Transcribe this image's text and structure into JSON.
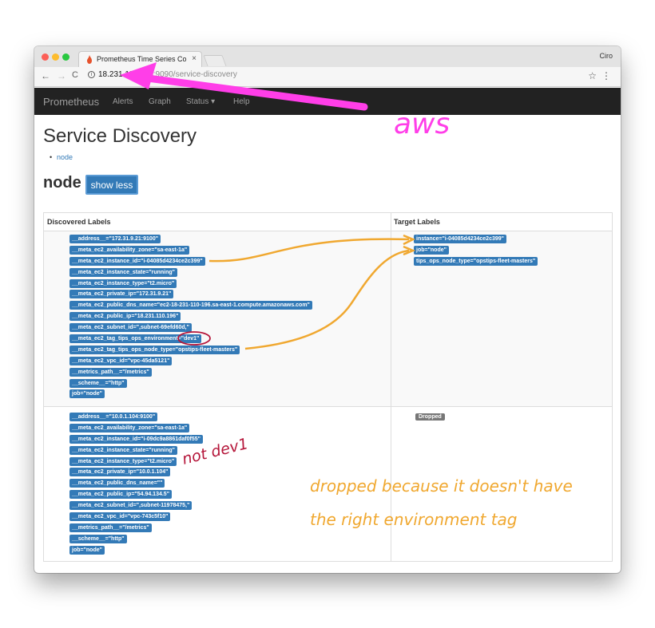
{
  "browser": {
    "tab_title": "Prometheus Time Series Colle",
    "tab_close": "×",
    "profile_name": "Ciro",
    "url_host": "18.231.110.196",
    "url_rest": ":9090/service-discovery",
    "back": "←",
    "forward": "→",
    "reload": "C",
    "info": "i",
    "star": "☆",
    "menu": "⋮"
  },
  "navbar": {
    "brand": "Prometheus",
    "links": [
      "Alerts",
      "Graph",
      "Status ▾",
      "Help"
    ],
    "background": "#222222",
    "link_color": "#9d9d9d"
  },
  "page": {
    "title": "Service Discovery",
    "jobs": [
      "node"
    ],
    "bullet": "•",
    "pool_title": "node",
    "toggle_label": "show less"
  },
  "table": {
    "headers": [
      "Discovered Labels",
      "Target Labels"
    ],
    "rows": [
      {
        "discovered": [
          "__address__=\"172.31.9.21:9100\"",
          "__meta_ec2_availability_zone=\"sa-east-1a\"",
          "__meta_ec2_instance_id=\"i-04085d4234ce2c399\"",
          "__meta_ec2_instance_state=\"running\"",
          "__meta_ec2_instance_type=\"t2.micro\"",
          "__meta_ec2_private_ip=\"172.31.9.21\"",
          "__meta_ec2_public_dns_name=\"ec2-18-231-110-196.sa-east-1.compute.amazonaws.com\"",
          "__meta_ec2_public_ip=\"18.231.110.196\"",
          "__meta_ec2_subnet_id=\",subnet-69efd60d,\"",
          "__meta_ec2_tag_tips_ops_environment=\"dev1\"",
          "__meta_ec2_tag_tips_ops_node_type=\"opstips-fleet-masters\"",
          "__meta_ec2_vpc_id=\"vpc-45da5121\"",
          "__metrics_path__=\"/metrics\"",
          "__scheme__=\"http\"",
          "job=\"node\""
        ],
        "target": [
          "instance=\"i-04085d4234ce2c399\"",
          "job=\"node\"",
          "tips_ops_node_type=\"opstips-fleet-masters\""
        ]
      },
      {
        "discovered": [
          "__address__=\"10.0.1.104:9100\"",
          "__meta_ec2_availability_zone=\"sa-east-1a\"",
          "__meta_ec2_instance_id=\"i-09dc9a8861daf0f55\"",
          "__meta_ec2_instance_state=\"running\"",
          "__meta_ec2_instance_type=\"t2.micro\"",
          "__meta_ec2_private_ip=\"10.0.1.104\"",
          "__meta_ec2_public_dns_name=\"\"",
          "__meta_ec2_public_ip=\"54.94.134.5\"",
          "__meta_ec2_subnet_id=\",subnet-11978475,\"",
          "__meta_ec2_vpc_id=\"vpc-743c5f10\"",
          "__metrics_path__=\"/metrics\"",
          "__scheme__=\"http\"",
          "job=\"node\""
        ],
        "status": "Dropped"
      }
    ]
  },
  "annotations": {
    "aws": "aws",
    "not_dev1": "not dev1",
    "dropped_line1": "dropped because it doesn't have",
    "dropped_line2": "the right environment tag",
    "arrow_pink": "#ff3ee8",
    "arrow_orange": "#f0a830",
    "circle_red": "#b5163a"
  },
  "colors": {
    "label_bg": "#337ab7",
    "dropped_bg": "#777777"
  }
}
